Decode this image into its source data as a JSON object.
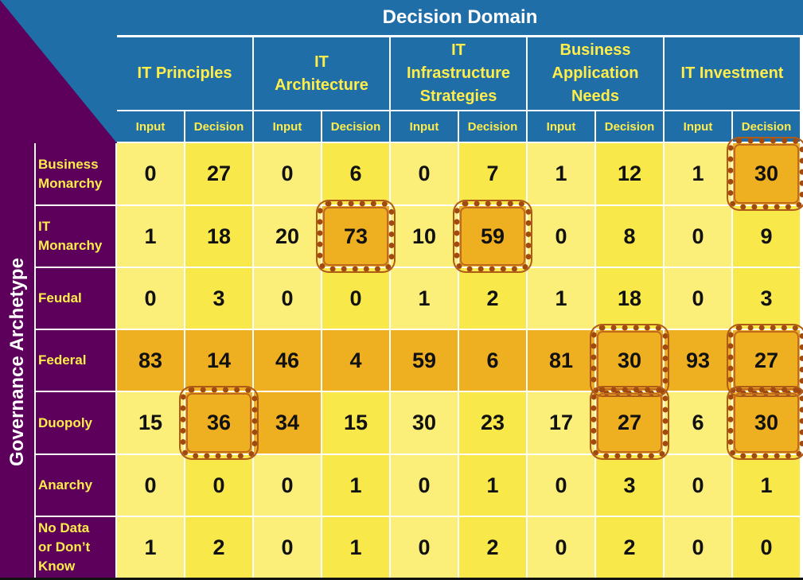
{
  "chart_data": {
    "type": "table",
    "title": "Decision Domain",
    "column_group_label": "Decision Domain",
    "row_group_label": "Governance Archetype",
    "domains": [
      "IT Principles",
      "IT Architecture",
      "IT Infrastructure Strategies",
      "Business Application Needs",
      "IT Investment"
    ],
    "domain_lines": [
      [
        "IT Principles"
      ],
      [
        "IT",
        "Architecture"
      ],
      [
        "IT",
        "Infrastructure",
        "Strategies"
      ],
      [
        "Business",
        "Application",
        "Needs"
      ],
      [
        "IT Investment"
      ]
    ],
    "subcolumns": [
      "Input",
      "Decision"
    ],
    "rows": [
      "Business Monarchy",
      "IT Monarchy",
      "Feudal",
      "Federal",
      "Duopoly",
      "Anarchy",
      "No Data or Don’t Know"
    ],
    "row_lines": [
      [
        "Business",
        "Monarchy"
      ],
      [
        "IT",
        "Monarchy"
      ],
      [
        "Feudal"
      ],
      [
        "Federal"
      ],
      [
        "Duopoly"
      ],
      [
        "Anarchy"
      ],
      [
        "No Data",
        "or Don’t",
        "Know"
      ]
    ],
    "values": [
      [
        0,
        27,
        0,
        6,
        0,
        7,
        1,
        12,
        1,
        30
      ],
      [
        1,
        18,
        20,
        73,
        10,
        59,
        0,
        8,
        0,
        9
      ],
      [
        0,
        3,
        0,
        0,
        1,
        2,
        1,
        18,
        0,
        3
      ],
      [
        83,
        14,
        46,
        4,
        59,
        6,
        81,
        30,
        93,
        27
      ],
      [
        15,
        36,
        34,
        15,
        30,
        23,
        17,
        27,
        6,
        30
      ],
      [
        0,
        0,
        0,
        1,
        0,
        1,
        0,
        3,
        0,
        1
      ],
      [
        1,
        2,
        0,
        1,
        0,
        2,
        0,
        2,
        0,
        0
      ]
    ],
    "highlighted_orange": [
      [
        3,
        0
      ],
      [
        3,
        1
      ],
      [
        3,
        2
      ],
      [
        3,
        3
      ],
      [
        3,
        4
      ],
      [
        3,
        5
      ],
      [
        3,
        6
      ],
      [
        3,
        7
      ],
      [
        3,
        8
      ],
      [
        3,
        9
      ],
      [
        4,
        2
      ]
    ],
    "circled": [
      [
        0,
        9
      ],
      [
        1,
        3
      ],
      [
        1,
        5
      ],
      [
        3,
        7
      ],
      [
        3,
        9
      ],
      [
        4,
        1
      ],
      [
        4,
        7
      ],
      [
        4,
        9
      ]
    ],
    "colors": {
      "header_blue": "#1f6ea8",
      "row_purple": "#5c005c",
      "header_text": "#ffed4a",
      "input_cell": "#fbef7a",
      "decision_cell": "#f9e84a",
      "highlight": "#eeb020",
      "ring": "#a04a12"
    }
  }
}
